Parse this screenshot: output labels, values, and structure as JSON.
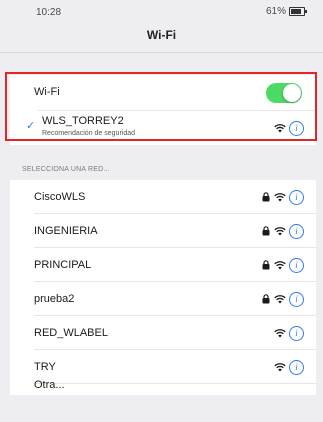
{
  "status_bar": {
    "time": "10:28",
    "battery": "61%"
  },
  "nav": {
    "title": "Wi-Fi"
  },
  "wifi_toggle": {
    "label": "Wi-Fi",
    "enabled": true
  },
  "connected_network": {
    "name": "WLS_TORREY2",
    "subtitle": "Recomendación de seguridad"
  },
  "section": {
    "header": "SELECCIONA UNA RED..."
  },
  "networks": [
    {
      "name": "CiscoWLS",
      "locked": true
    },
    {
      "name": "INGENIERIA",
      "locked": true
    },
    {
      "name": "PRINCIPAL",
      "locked": true
    },
    {
      "name": "prueba2",
      "locked": true
    },
    {
      "name": "RED_WLABEL",
      "locked": false
    },
    {
      "name": "TRY",
      "locked": false
    },
    {
      "name": "Otra...",
      "locked": false,
      "other": true
    }
  ],
  "colors": {
    "toggle_on": "#4cd964",
    "accent": "#3478f6",
    "highlight": "#e02626"
  }
}
